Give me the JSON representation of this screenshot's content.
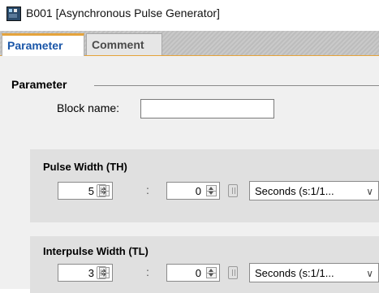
{
  "window": {
    "title": "B001 [Asynchronous Pulse Generator]",
    "icon": "app-block-icon"
  },
  "tabs": [
    {
      "label": "Parameter",
      "active": true
    },
    {
      "label": "Comment",
      "active": false
    }
  ],
  "parameter_group": {
    "title": "Parameter",
    "block_name_label": "Block name:",
    "block_name_value": ""
  },
  "pulse_width": {
    "title": "Pulse Width (TH)",
    "value1": "5",
    "separator": ":",
    "value2": "0",
    "unit": "Seconds (s:1/1..."
  },
  "interpulse_width": {
    "title": "Interpulse Width (TL)",
    "value1": "3",
    "separator": ":",
    "value2": "0",
    "unit": "Seconds (s:1/1..."
  },
  "icons": {
    "spinner": "spinner-arrows-icon",
    "parameter_ref": "parameter-reference-icon",
    "dropdown": "chevron-down-icon"
  },
  "colors": {
    "active_tab_text": "#1a56a8",
    "tab_accent": "#e5a33b",
    "panel_bg": "#e0e0e0",
    "content_bg": "#f0f0f0"
  }
}
